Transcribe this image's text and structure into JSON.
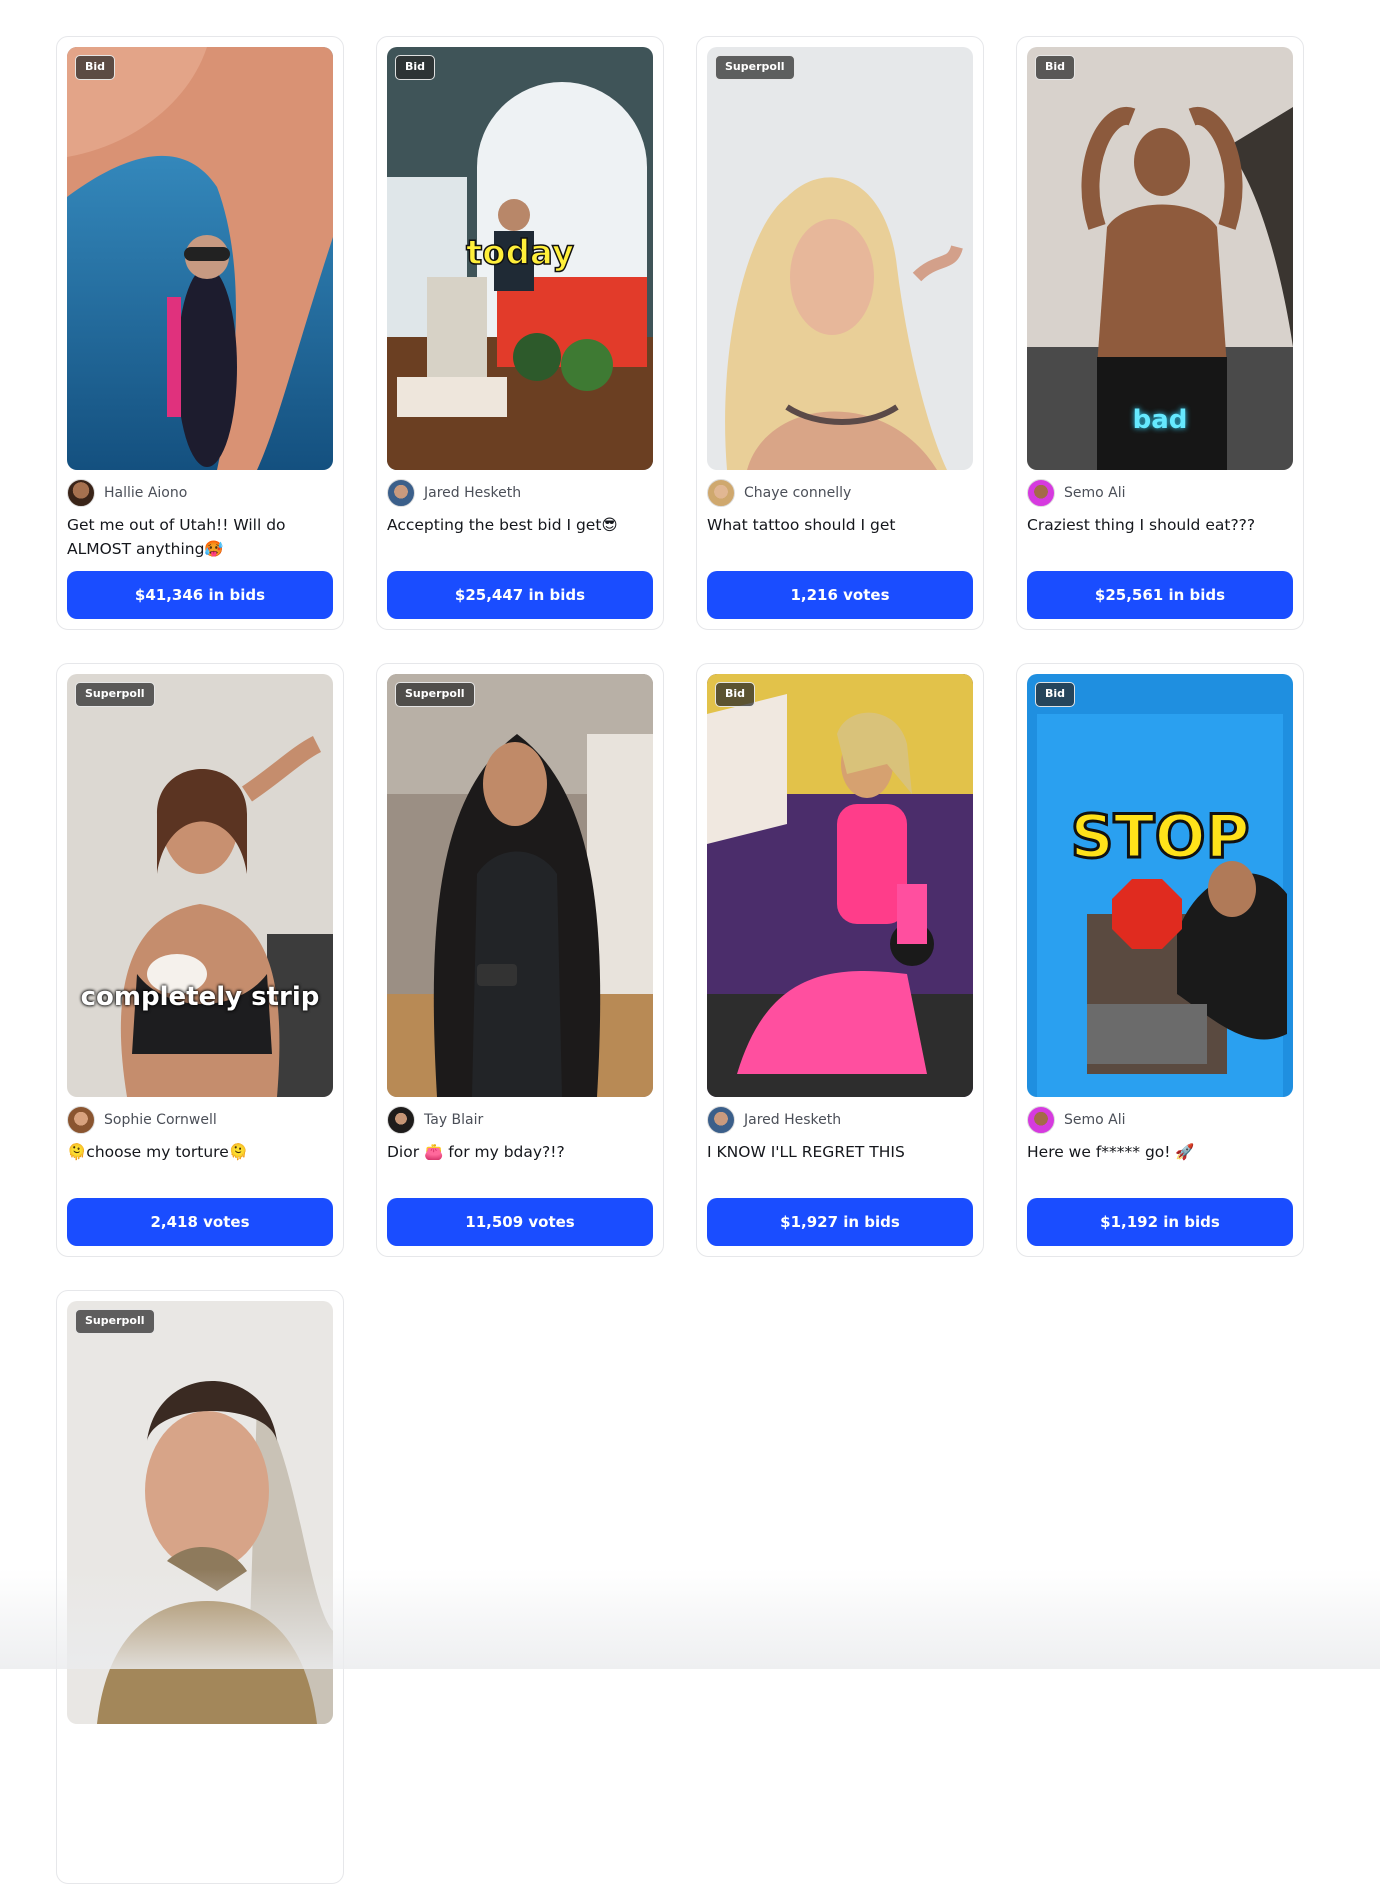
{
  "cards": [
    {
      "badge": "Bid",
      "creator": "Hallie Aiono",
      "caption": "Get me out of Utah!! Will do ALMOST anything🥵",
      "action": "$41,346 in bids",
      "overlay": ""
    },
    {
      "badge": "Bid",
      "creator": "Jared Hesketh",
      "caption": "Accepting the best bid I get😎",
      "action": "$25,447 in bids",
      "overlay": "today"
    },
    {
      "badge": "Superpoll",
      "creator": "Chaye connelly",
      "caption": "What tattoo should I get",
      "action": "1,216 votes",
      "overlay": ""
    },
    {
      "badge": "Bid",
      "creator": "Semo Ali",
      "caption": "Craziest thing I should eat???",
      "action": "$25,561 in bids",
      "overlay": "bad"
    },
    {
      "badge": "Superpoll",
      "creator": "Sophie Cornwell",
      "caption": "🫠choose my torture🫠",
      "action": "2,418 votes",
      "overlay": "completely strip"
    },
    {
      "badge": "Superpoll",
      "creator": "Tay Blair",
      "caption": "Dior 👛 for my bday?!?",
      "action": "11,509 votes",
      "overlay": ""
    },
    {
      "badge": "Bid",
      "creator": "Jared Hesketh",
      "caption": "I KNOW I'LL REGRET THIS",
      "action": "$1,927 in bids",
      "overlay": ""
    },
    {
      "badge": "Bid",
      "creator": "Semo Ali",
      "caption": "Here we f***** go! 🚀",
      "action": "$1,192 in bids",
      "overlay": "STOP"
    },
    {
      "badge": "Superpoll",
      "creator": "",
      "caption": "",
      "action": "",
      "overlay": ""
    }
  ]
}
